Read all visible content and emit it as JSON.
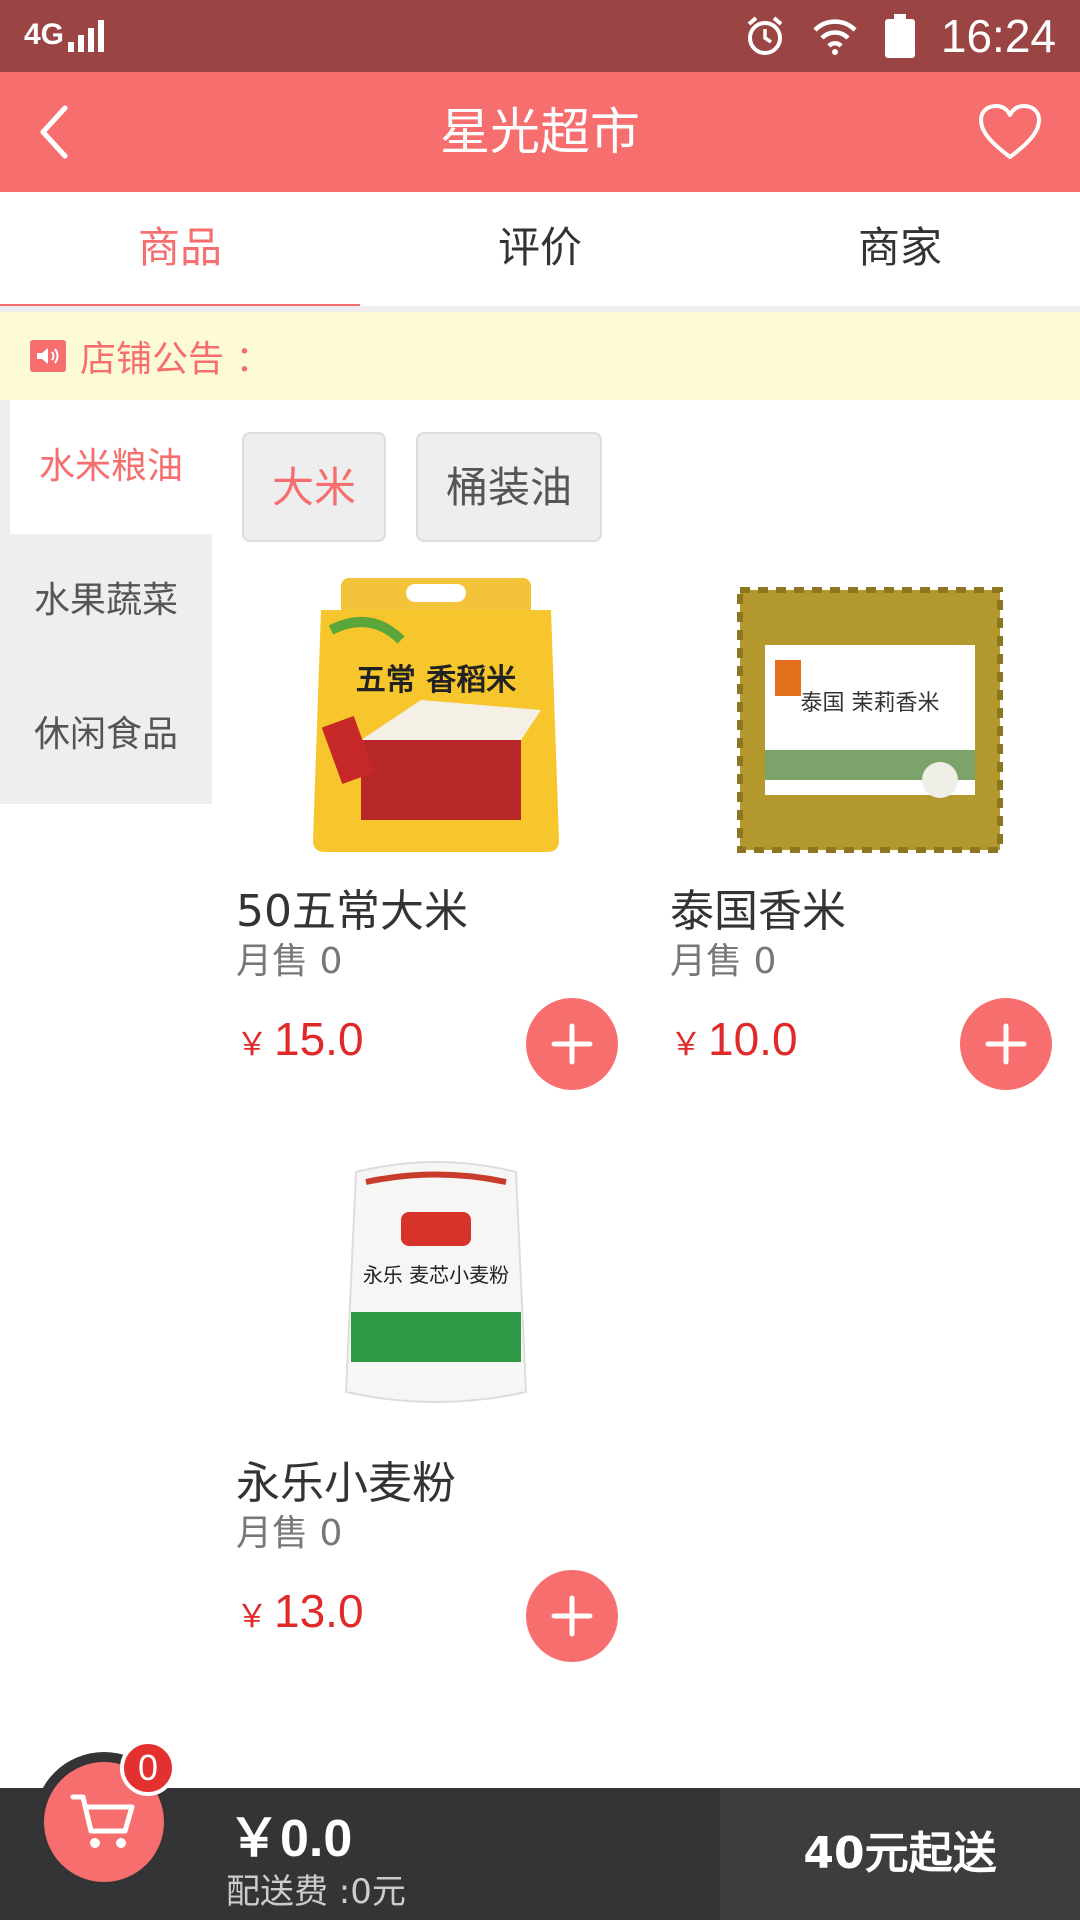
{
  "status_bar": {
    "network": "4G",
    "time": "16:24"
  },
  "header": {
    "title": "星光超市"
  },
  "tabs": [
    {
      "label": "商品",
      "active": true
    },
    {
      "label": "评价",
      "active": false
    },
    {
      "label": "商家",
      "active": false
    }
  ],
  "notice": {
    "label": "店铺公告 ："
  },
  "categories": [
    {
      "label": "水米粮油",
      "active": true
    },
    {
      "label": "水果蔬菜",
      "active": false
    },
    {
      "label": "休闲食品",
      "active": false
    }
  ],
  "subcategories": [
    {
      "label": "大米",
      "active": true
    },
    {
      "label": "桶装油",
      "active": false
    }
  ],
  "products": [
    {
      "name": "50五常大米",
      "sales": "月售 0",
      "currency": "￥",
      "price": "15.0",
      "package_text": "五常 香稻米"
    },
    {
      "name": "泰国香米",
      "sales": "月售 0",
      "currency": "￥",
      "price": "10.0",
      "package_text": "泰国 茉莉香米"
    },
    {
      "name": "永乐小麦粉",
      "sales": "月售 0",
      "currency": "￥",
      "price": "13.0",
      "package_text": "永乐 麦芯小麦粉"
    }
  ],
  "cart": {
    "count": "0",
    "total": "￥0.0",
    "delivery_fee": "配送费 :0元",
    "min_order": "40元起送"
  },
  "colors": {
    "accent": "#f76e6e",
    "status_bar": "#9a4444",
    "price": "#e02a2a",
    "cart_bar": "#343436",
    "notice_bg": "#fdfbd6"
  }
}
